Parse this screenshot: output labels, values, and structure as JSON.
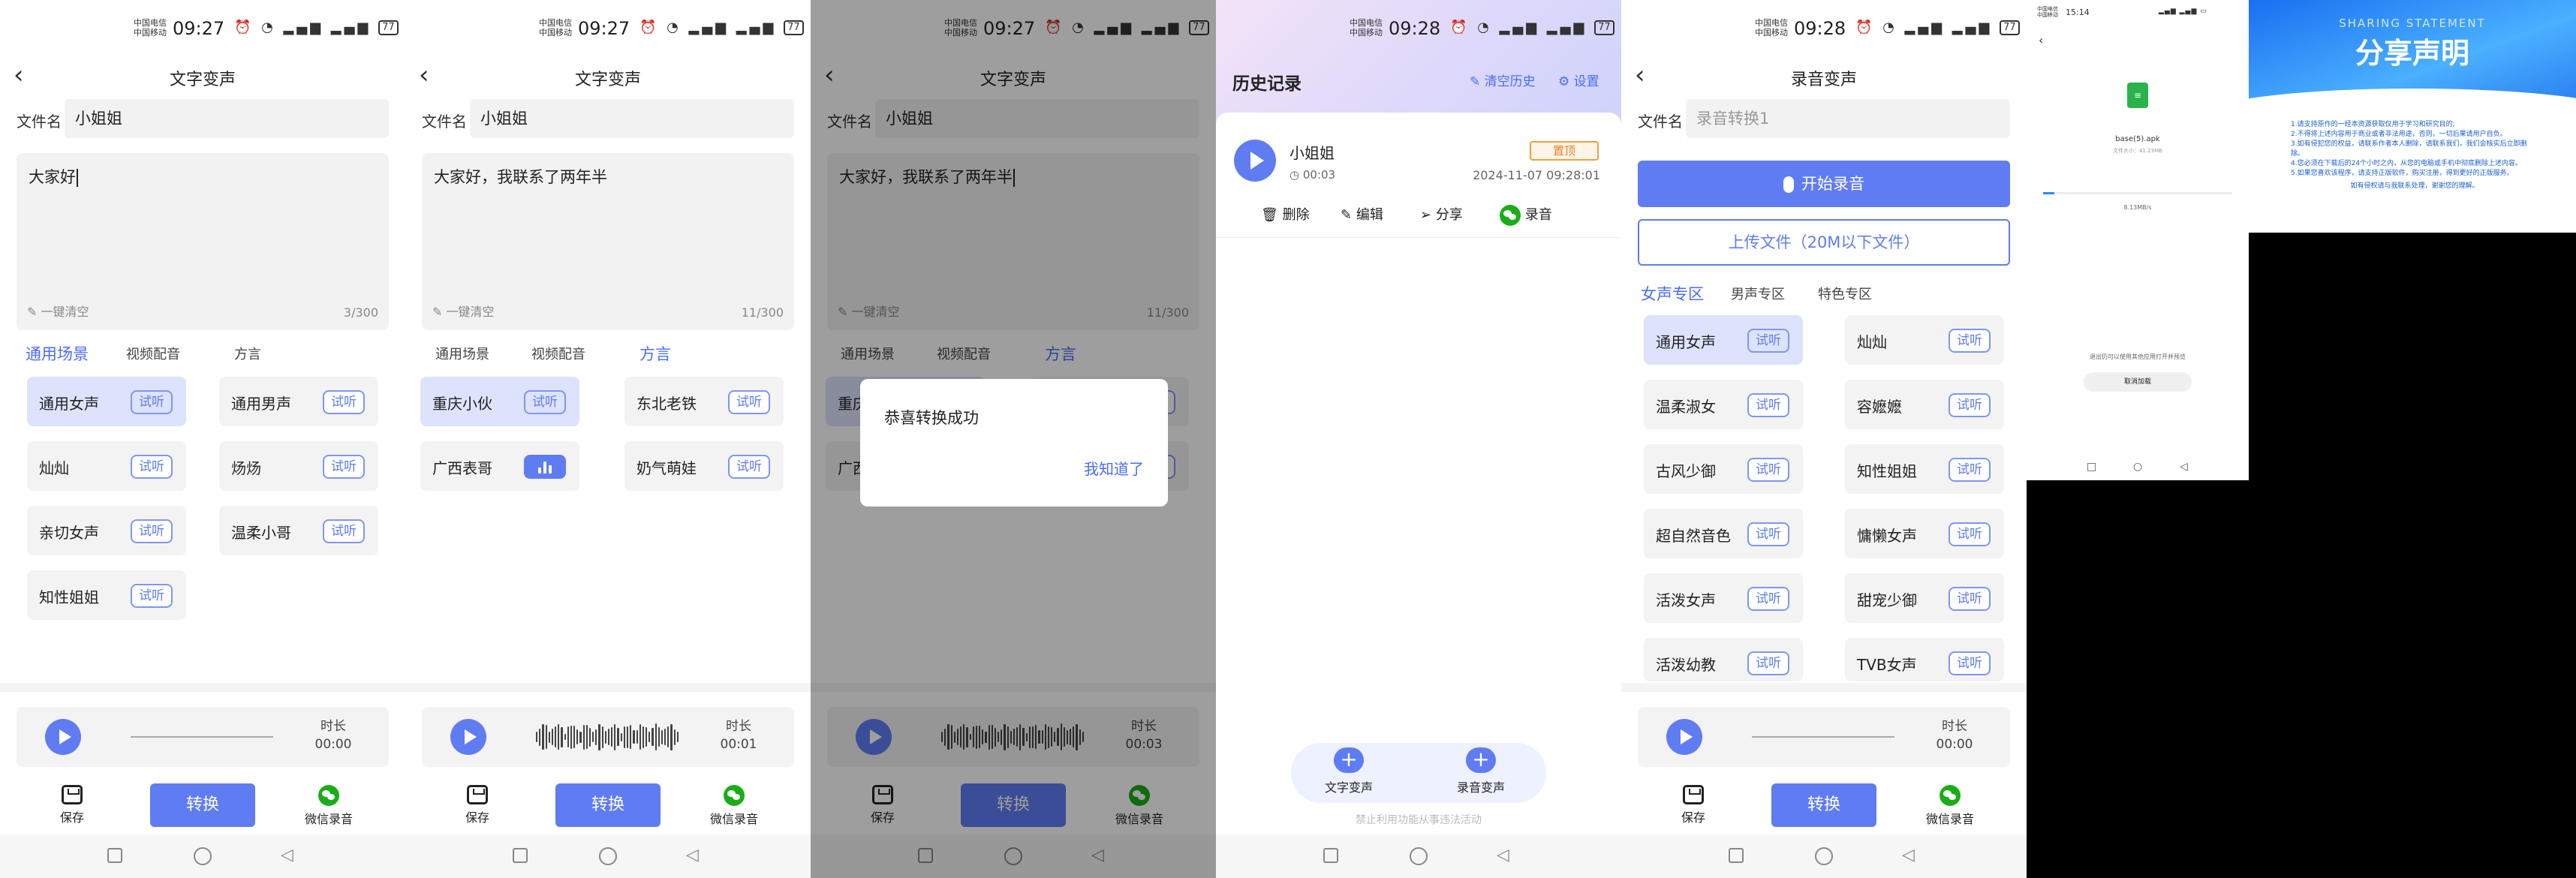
{
  "status": {
    "carrier1": "中国电信",
    "carrier2": "中国移动",
    "times": [
      "09:27",
      "09:27",
      "09:27",
      "09:28",
      "09:28"
    ],
    "battery": "77"
  },
  "tts": {
    "title": "文字变声",
    "filename_label": "文件名",
    "filename": "小姐姐",
    "clear_label": "一键清空",
    "texts": [
      "大家好",
      "大家好，我联系了两年半",
      "大家好，我联系了两年半"
    ],
    "counts": [
      "3/300",
      "11/300",
      "11/300"
    ],
    "categories": [
      "通用场景",
      "视频配音",
      "方言"
    ],
    "general_voices": [
      "通用女声",
      "通用男声",
      "灿灿",
      "炀炀",
      "亲切女声",
      "温柔小哥",
      "知性姐姐"
    ],
    "dialect_voices": [
      "重庆小伙",
      "东北老铁",
      "广西表哥",
      "奶气萌娃"
    ],
    "try_label": "试听",
    "duration_label": "时长",
    "durations": [
      "00:00",
      "00:01",
      "00:03"
    ],
    "save_label": "保存",
    "convert_label": "转换",
    "wechat_label": "微信录音"
  },
  "dialog": {
    "message": "恭喜转换成功",
    "ok": "我知道了"
  },
  "history": {
    "title": "历史记录",
    "clear": "清空历史",
    "settings": "设置",
    "item": {
      "name": "小姐姐",
      "duration": "00:03",
      "date": "2024-11-07 09:28:01",
      "pin": "置顶",
      "actions": [
        "删除",
        "编辑",
        "分享",
        "录音"
      ]
    },
    "fab_tts": "文字变声",
    "fab_rec": "录音变声",
    "note": "禁止利用功能从事违法活动"
  },
  "recording": {
    "title": "录音变声",
    "filename_placeholder": "录音转换1",
    "record_btn": "开始录音",
    "upload_btn": "上传文件（20M以下文件）",
    "zones": [
      "女声专区",
      "男声专区",
      "特色专区"
    ],
    "voices": [
      "通用女声",
      "灿灿",
      "温柔淑女",
      "容嬷嬷",
      "古风少御",
      "知性姐姐",
      "超自然音色",
      "慵懒女声",
      "活泼女声",
      "甜宠少御",
      "活泼幼教",
      "TVB女声"
    ]
  },
  "install": {
    "time": "15:14",
    "apk_name": "base(5).apk",
    "apk_sub": "文件大小：41.23MB",
    "speed": "8.13MB/s",
    "progress": 0.06,
    "note": "退出仍可以使用其他应用打开并预览",
    "cancel": "取消加载"
  },
  "share": {
    "title_en": "SHARING STATEMENT",
    "title_cn": "分享声明",
    "lines": [
      "1.请支持原作的一经本资源获取仅用于学习和研究目的;",
      "2.不得将上述内容用于商业或者非法用途，否则，一切后果请用户自负。",
      "3.如有侵犯您的权益，请联系作者本人删除，请联系我们，我们会核实后立即删除。",
      "4.您必须在下载后的24个小时之内，从您的电脑或手机中彻底删除上述内容。",
      "5.如果您喜欢该程序，请支持正版软件，购买注册，得到更好的正版服务。",
      "如有侵权请与我联系处理，谢谢您的理解。"
    ]
  }
}
